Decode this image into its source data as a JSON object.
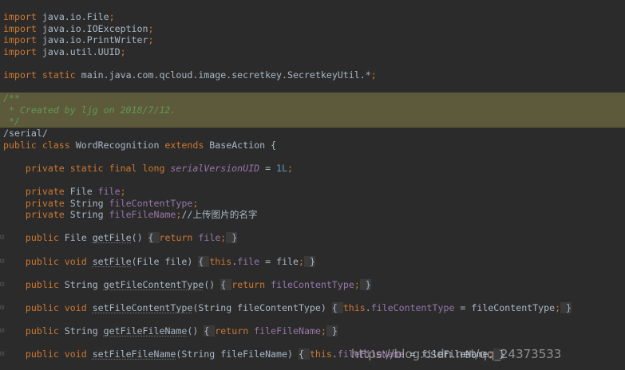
{
  "code": {
    "imports": [
      "java.io.File",
      "java.io.IOException",
      "java.io.PrintWriter",
      "java.util.UUID"
    ],
    "static_import": "main.java.com.qcloud.image.secretkey.SecretkeyUtil.*",
    "doc_comment": {
      "open": "/**",
      "body": " * Created by ljg on 2018/7/12.",
      "close": " */"
    },
    "serial_tag": "/serial/",
    "class_name": "WordRecognition",
    "base_class": "BaseAction",
    "serial_field": "serialVersionUID",
    "serial_value": "1L",
    "fields": [
      {
        "type": "File",
        "name": "file",
        "comment": ""
      },
      {
        "type": "String",
        "name": "fileContentType",
        "comment": ""
      },
      {
        "type": "String",
        "name": "fileFileName",
        "comment": "//上传图片的名字"
      }
    ],
    "methods": [
      {
        "method": "getFile",
        "ret": "File",
        "params": "",
        "body_field": "file"
      },
      {
        "method": "setFile",
        "ret": "void",
        "params": "File file",
        "body_field": "file",
        "body_value": "file"
      },
      {
        "method": "getFileContentType",
        "ret": "String",
        "params": "",
        "body_field": "fileContentType"
      },
      {
        "method": "setFileContentType",
        "ret": "void",
        "params": "String fileContentType",
        "body_field": "fileContentType",
        "body_value": "fileContentType"
      },
      {
        "method": "getFileFileName",
        "ret": "String",
        "params": "",
        "body_field": "fileFileName"
      },
      {
        "method": "setFileFileName",
        "ret": "void",
        "params": "String fileFileName",
        "body_field": "fileFileName",
        "body_value": "fileFileName"
      }
    ]
  },
  "watermark": "https://blog.csdn.net/qq_24373533",
  "colors": {
    "background": "#2b2b2b",
    "keyword": "#cc7832",
    "comment": "#629755",
    "field": "#9876aa",
    "number": "#6897bb",
    "text": "#a9b7c6",
    "highlight": "#5c5a3a"
  }
}
